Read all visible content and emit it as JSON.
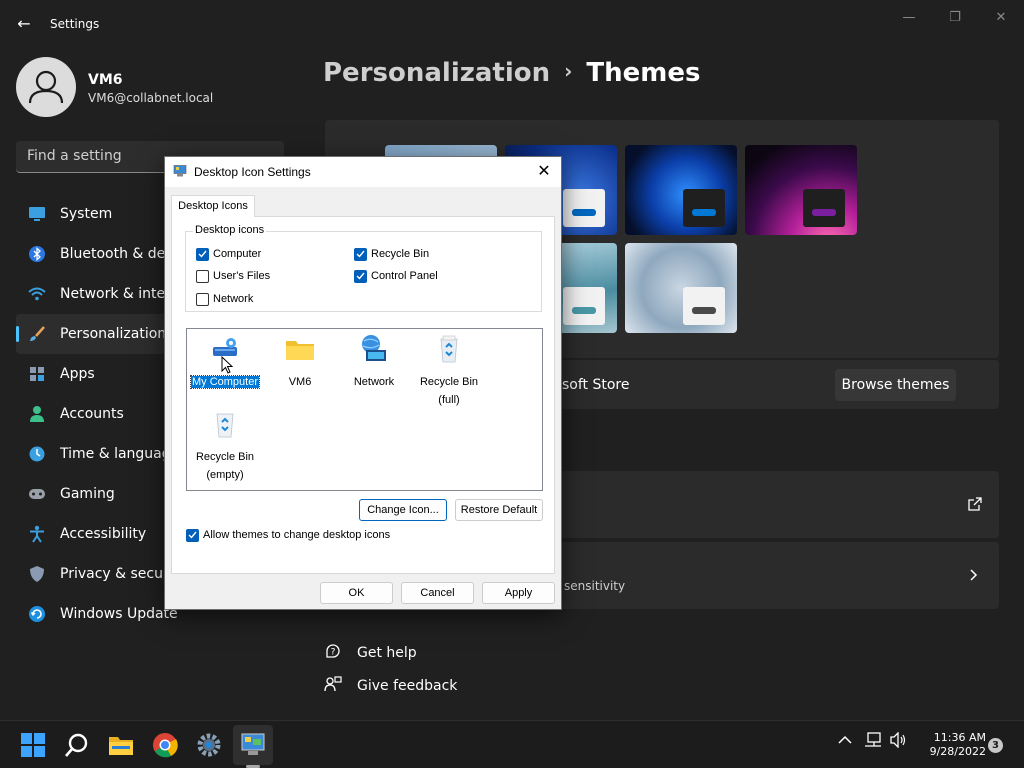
{
  "window": {
    "app_title": "Settings",
    "back_glyph": "←",
    "minimize_glyph": "—",
    "maximize_glyph": "❐",
    "close_glyph": "✕"
  },
  "user": {
    "name": "VM6",
    "email": "VM6@collabnet.local"
  },
  "search": {
    "placeholder": "Find a setting"
  },
  "nav": {
    "items": [
      {
        "label": "System",
        "icon": "monitor-icon"
      },
      {
        "label": "Bluetooth & devices",
        "icon": "bluetooth-icon"
      },
      {
        "label": "Network & internet",
        "icon": "wifi-icon"
      },
      {
        "label": "Personalization",
        "icon": "brush-icon",
        "active": true
      },
      {
        "label": "Apps",
        "icon": "apps-icon"
      },
      {
        "label": "Accounts",
        "icon": "person-icon"
      },
      {
        "label": "Time & language",
        "icon": "clock-globe-icon"
      },
      {
        "label": "Gaming",
        "icon": "gamepad-icon"
      },
      {
        "label": "Accessibility",
        "icon": "accessibility-icon"
      },
      {
        "label": "Privacy & security",
        "icon": "shield-icon"
      },
      {
        "label": "Windows Update",
        "icon": "update-icon"
      }
    ]
  },
  "header": {
    "breadcrumb_parent": "Personalization",
    "separator": "›",
    "page_title": "Themes"
  },
  "main": {
    "store_text": "soft Store",
    "browse_button": "Browse themes",
    "sensitivity_text": "sensitivity",
    "get_help": "Get help",
    "give_feedback": "Give feedback"
  },
  "dialog": {
    "title": "Desktop Icon Settings",
    "tab_label": "Desktop Icons",
    "group_label": "Desktop icons",
    "checkboxes": [
      {
        "label": "Computer",
        "checked": true
      },
      {
        "label": "Recycle Bin",
        "checked": true
      },
      {
        "label": "User's Files",
        "checked": false
      },
      {
        "label": "Control Panel",
        "checked": true
      },
      {
        "label": "Network",
        "checked": false
      }
    ],
    "icons": [
      {
        "line1": "My Computer",
        "line2": "",
        "selected": true
      },
      {
        "line1": "VM6",
        "line2": ""
      },
      {
        "line1": "Network",
        "line2": ""
      },
      {
        "line1": "Recycle Bin",
        "line2": "(full)"
      },
      {
        "line1": "Recycle Bin",
        "line2": "(empty)"
      }
    ],
    "change_icon_button": "Change Icon...",
    "restore_default_button": "Restore Default",
    "allow_themes_label": "Allow themes to change desktop icons",
    "allow_themes_checked": true,
    "ok_button": "OK",
    "cancel_button": "Cancel",
    "apply_button": "Apply"
  },
  "taskbar": {
    "time": "11:36 AM",
    "date": "9/28/2022",
    "notification_count": "3"
  },
  "colors": {
    "accent": "#4cc2ff",
    "checkbox_blue": "#005fb8",
    "selection_blue": "#0078d7"
  }
}
